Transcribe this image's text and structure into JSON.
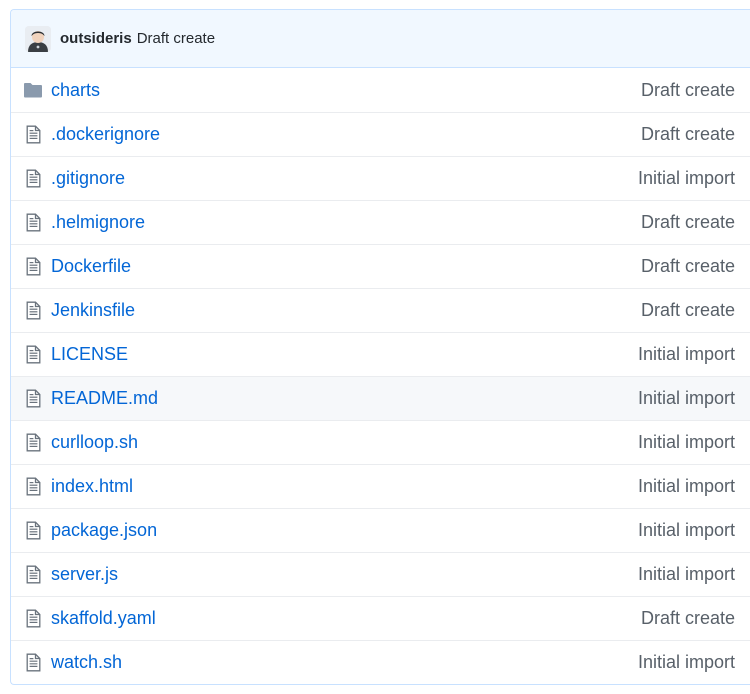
{
  "commit": {
    "author": "outsideris",
    "message": "Draft create"
  },
  "files": [
    {
      "name": "charts",
      "type": "folder",
      "icon": "folder-icon",
      "message": "Draft create"
    },
    {
      "name": ".dockerignore",
      "type": "file",
      "icon": "file-icon",
      "message": "Draft create"
    },
    {
      "name": ".gitignore",
      "type": "file",
      "icon": "file-icon",
      "message": "Initial import"
    },
    {
      "name": ".helmignore",
      "type": "file",
      "icon": "file-icon",
      "message": "Draft create"
    },
    {
      "name": "Dockerfile",
      "type": "file",
      "icon": "file-icon",
      "message": "Draft create"
    },
    {
      "name": "Jenkinsfile",
      "type": "file",
      "icon": "file-icon",
      "message": "Draft create"
    },
    {
      "name": "LICENSE",
      "type": "file",
      "icon": "file-icon",
      "message": "Initial import"
    },
    {
      "name": "README.md",
      "type": "file",
      "icon": "file-icon",
      "message": "Initial import"
    },
    {
      "name": "curlloop.sh",
      "type": "file",
      "icon": "file-icon",
      "message": "Initial import"
    },
    {
      "name": "index.html",
      "type": "file",
      "icon": "file-icon",
      "message": "Initial import"
    },
    {
      "name": "package.json",
      "type": "file",
      "icon": "file-icon",
      "message": "Initial import"
    },
    {
      "name": "server.js",
      "type": "file",
      "icon": "file-icon",
      "message": "Initial import"
    },
    {
      "name": "skaffold.yaml",
      "type": "file",
      "icon": "file-icon",
      "message": "Draft create"
    },
    {
      "name": "watch.sh",
      "type": "file",
      "icon": "file-icon",
      "message": "Initial import"
    }
  ],
  "colors": {
    "link": "#0366d6",
    "muted": "#586069",
    "header_bg": "#f1f8ff",
    "border": "#c8e1ff",
    "icon": "#6a737d",
    "folder_icon": "#79b8ff"
  }
}
